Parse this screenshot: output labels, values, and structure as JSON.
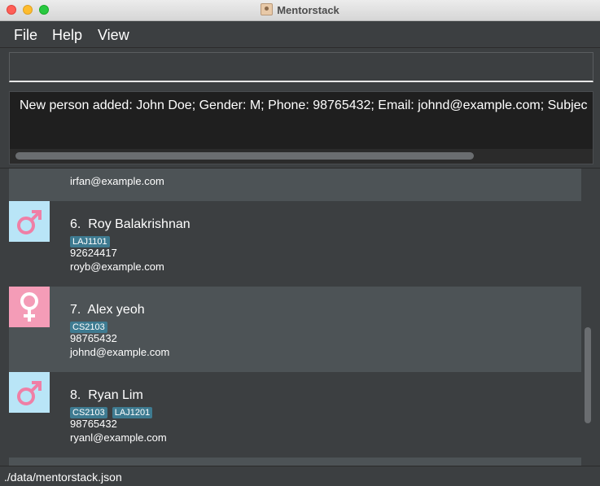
{
  "window": {
    "title": "Mentorstack"
  },
  "menu": {
    "items": [
      "File",
      "Help",
      "View"
    ]
  },
  "command_box": {
    "value": ""
  },
  "result": {
    "text": "New person added: John Doe; Gender: M; Phone: 98765432; Email: johnd@example.com; Subjec"
  },
  "persons": {
    "partial_email": "irfan@example.com",
    "cards": [
      {
        "index": "6.",
        "name": "Roy Balakrishnan",
        "gender_icon": "male-icon",
        "tags": [
          "LAJ1101"
        ],
        "phone": "92624417",
        "email": "royb@example.com"
      },
      {
        "index": "7.",
        "name": "Alex yeoh",
        "gender_icon": "female-icon",
        "tags": [
          "CS2103"
        ],
        "phone": "98765432",
        "email": "johnd@example.com"
      },
      {
        "index": "8.",
        "name": "Ryan Lim",
        "gender_icon": "male-icon",
        "tags": [
          "CS2103",
          "LAJ1201"
        ],
        "phone": "98765432",
        "email": "ryanl@example.com"
      }
    ]
  },
  "status": {
    "path": "./data/mentorstack.json"
  },
  "colors": {
    "male_bg": "#b9e5f7",
    "female_bg": "#f49cb7",
    "symbol_pink": "#ef7fa6",
    "tag_bg": "#3e7b91"
  }
}
